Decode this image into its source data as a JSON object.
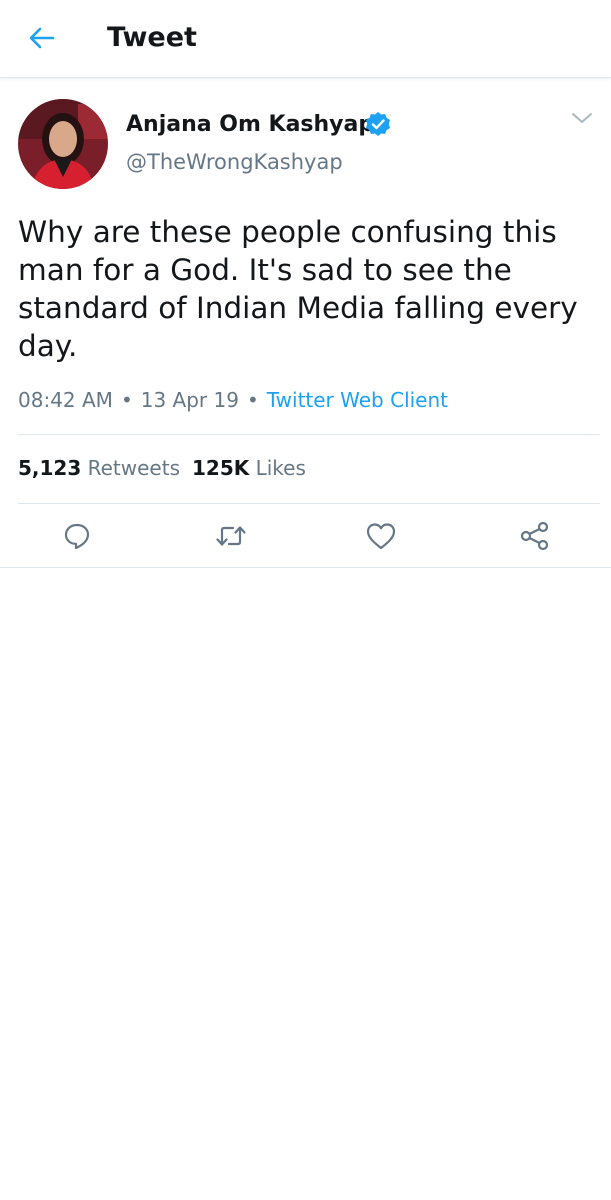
{
  "header": {
    "title": "Tweet",
    "back_icon": "arrow-left-icon"
  },
  "colors": {
    "accent": "#1da1f2",
    "secondary_text": "#657786",
    "primary_text": "#14171a",
    "divider": "#e1e8ed"
  },
  "tweet": {
    "author": {
      "display_name": "Anjana Om Kashyap",
      "handle": "@TheWrongKashyap",
      "verified": true
    },
    "text": "Why are these people confusing this man for a God. It's sad to see the standard of Indian Media falling every day.",
    "time": "08:42 AM",
    "date": "13 Apr 19",
    "separator": "•",
    "client": "Twitter Web Client",
    "stats": {
      "retweets_count": "5,123",
      "retweets_label": "Retweets",
      "likes_count": "125K",
      "likes_label": "Likes"
    }
  },
  "actions": [
    {
      "icon": "reply-icon"
    },
    {
      "icon": "retweet-icon"
    },
    {
      "icon": "like-heart-icon"
    },
    {
      "icon": "share-icon"
    }
  ]
}
